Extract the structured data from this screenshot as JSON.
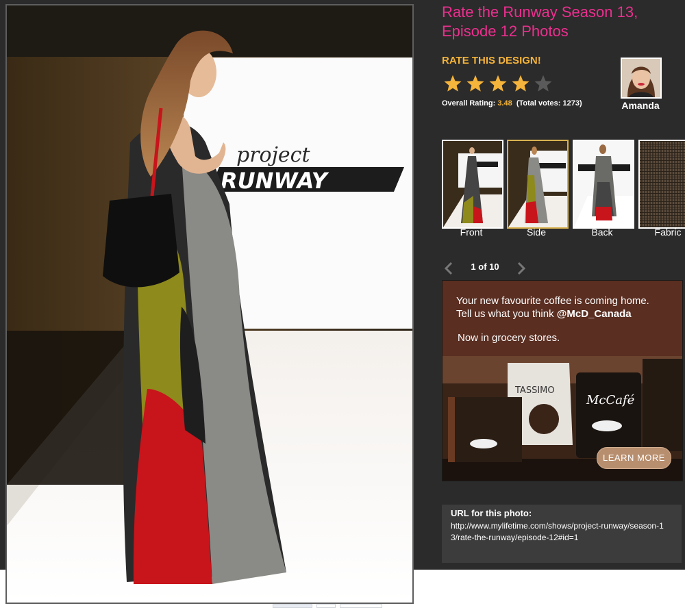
{
  "title": "Rate the Runway Season 13, Episode 12 Photos",
  "rating": {
    "label": "RATE THIS DESIGN!",
    "stars_filled": 4,
    "stars_total": 5,
    "overall_prefix": "Overall Rating:",
    "overall_value": "3.48",
    "total_votes": "(Total votes: 1273)"
  },
  "designer": {
    "name": "Amanda"
  },
  "thumbnails": [
    {
      "label": "Front",
      "selected": false
    },
    {
      "label": "Side",
      "selected": true
    },
    {
      "label": "Back",
      "selected": false
    },
    {
      "label": "Fabric",
      "selected": false
    }
  ],
  "pager": {
    "count": "1 of 10"
  },
  "ad": {
    "line1": "Your new favourite coffee is coming home.",
    "line2_prefix": "Tell us what you think",
    "handle": "@McD_Canada",
    "line3": "Now in grocery stores.",
    "brand": "McCafé",
    "brand2": "TASSIMO",
    "button": "LEARN MORE"
  },
  "photo": {
    "logo_top": "project",
    "logo_bottom": "RUNWAY"
  },
  "url": {
    "label": "URL for this photo:",
    "value": "http://www.mylifetime.com/shows/project-runway/season-13/rate-the-runway/episode-12#id=1"
  },
  "colors": {
    "title": "#ec2f8f",
    "accent": "#f5b43b",
    "panel_bg": "#2b2b2b",
    "ad_bg": "#5a2e21"
  }
}
